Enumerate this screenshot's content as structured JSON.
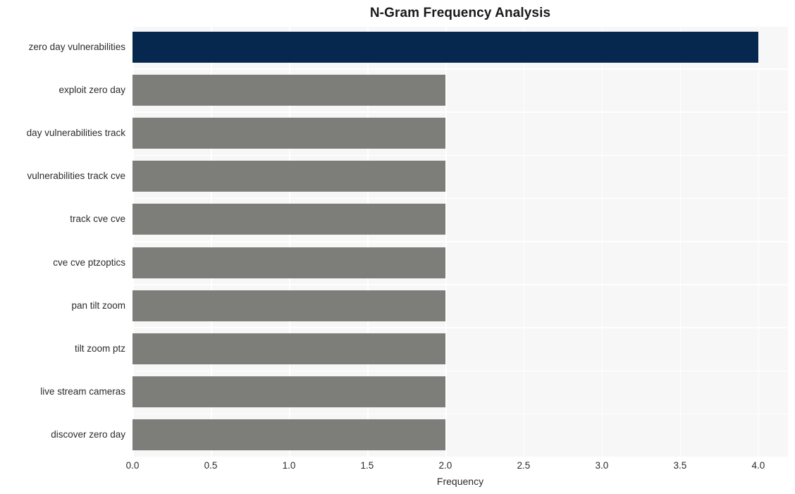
{
  "chart_data": {
    "type": "bar",
    "orientation": "horizontal",
    "title": "N-Gram Frequency Analysis",
    "xlabel": "Frequency",
    "ylabel": "",
    "categories": [
      "zero day vulnerabilities",
      "exploit zero day",
      "day vulnerabilities track",
      "vulnerabilities track cve",
      "track cve cve",
      "cve cve ptzoptics",
      "pan tilt zoom",
      "tilt zoom ptz",
      "live stream cameras",
      "discover zero day"
    ],
    "values": [
      4,
      2,
      2,
      2,
      2,
      2,
      2,
      2,
      2,
      2
    ],
    "bar_colors": [
      "#06284f",
      "#7d7d7a",
      "#7d7d7a",
      "#7d7d7a",
      "#7d7d7a",
      "#7d7d7a",
      "#7d7d7a",
      "#7d7d7a",
      "#7d7d7a",
      "#7d7d7a"
    ],
    "xlim": [
      0,
      4.19
    ],
    "xticks": [
      0,
      0.5,
      1,
      1.5,
      2,
      2.5,
      3,
      3.5,
      4
    ],
    "xtick_labels": [
      "0.0",
      "0.5",
      "1.0",
      "1.5",
      "2.0",
      "2.5",
      "3.0",
      "3.5",
      "4.0"
    ],
    "grid": true,
    "grid_color": "#ffffff",
    "plot_background": "#f7f7f7",
    "figure_background": "#ffffff",
    "legend": null,
    "highlight_color": "#06284f",
    "default_bar_color": "#7d7d7a"
  }
}
